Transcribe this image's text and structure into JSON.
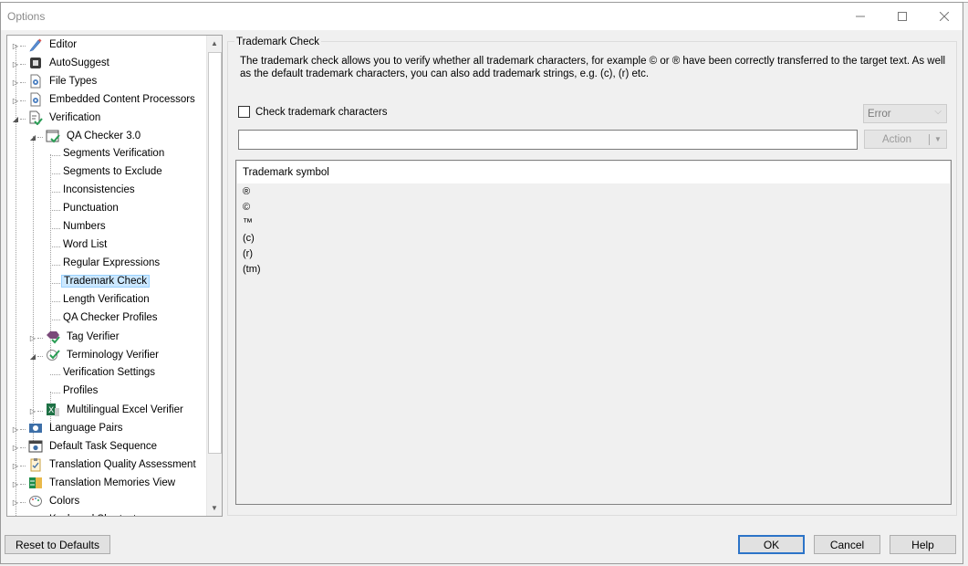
{
  "window": {
    "title": "Options",
    "controls": {
      "minimize": "minimize-icon",
      "maximize": "maximize-icon",
      "close": "close-icon"
    }
  },
  "tree": {
    "items": [
      {
        "label": "Editor",
        "level": 0,
        "expander": "collapsed",
        "icon": "pencil-icon"
      },
      {
        "label": "AutoSuggest",
        "level": 0,
        "expander": "collapsed",
        "icon": "autosuggest-icon"
      },
      {
        "label": "File Types",
        "level": 0,
        "expander": "collapsed",
        "icon": "gear-document-icon"
      },
      {
        "label": "Embedded Content Processors",
        "level": 0,
        "expander": "collapsed",
        "icon": "gear-document-icon"
      },
      {
        "label": "Verification",
        "level": 0,
        "expander": "expanded",
        "icon": "verification-document-icon"
      },
      {
        "label": "QA Checker 3.0",
        "level": 1,
        "expander": "expanded",
        "icon": "qa-checker-icon"
      },
      {
        "label": "Segments Verification",
        "level": 2,
        "expander": "none",
        "icon": ""
      },
      {
        "label": "Segments to Exclude",
        "level": 2,
        "expander": "none",
        "icon": ""
      },
      {
        "label": "Inconsistencies",
        "level": 2,
        "expander": "none",
        "icon": ""
      },
      {
        "label": "Punctuation",
        "level": 2,
        "expander": "none",
        "icon": ""
      },
      {
        "label": "Numbers",
        "level": 2,
        "expander": "none",
        "icon": ""
      },
      {
        "label": "Word List",
        "level": 2,
        "expander": "none",
        "icon": ""
      },
      {
        "label": "Regular Expressions",
        "level": 2,
        "expander": "none",
        "icon": ""
      },
      {
        "label": "Trademark Check",
        "level": 2,
        "expander": "none",
        "icon": "",
        "selected": true
      },
      {
        "label": "Length Verification",
        "level": 2,
        "expander": "none",
        "icon": ""
      },
      {
        "label": "QA Checker Profiles",
        "level": 2,
        "expander": "none",
        "icon": ""
      },
      {
        "label": "Tag Verifier",
        "level": 1,
        "expander": "collapsed",
        "icon": "tag-verifier-icon"
      },
      {
        "label": "Terminology Verifier",
        "level": 1,
        "expander": "expanded",
        "icon": "terminology-verifier-icon"
      },
      {
        "label": "Verification Settings",
        "level": 2,
        "expander": "none",
        "icon": ""
      },
      {
        "label": "Profiles",
        "level": 2,
        "expander": "none",
        "icon": ""
      },
      {
        "label": "Multilingual Excel Verifier",
        "level": 1,
        "expander": "collapsed",
        "icon": "excel-icon"
      },
      {
        "label": "Language Pairs",
        "level": 0,
        "expander": "collapsed",
        "icon": "language-pairs-icon"
      },
      {
        "label": "Default Task Sequence",
        "level": 0,
        "expander": "collapsed",
        "icon": "gear-window-icon"
      },
      {
        "label": "Translation Quality Assessment",
        "level": 0,
        "expander": "collapsed",
        "icon": "clipboard-icon"
      },
      {
        "label": "Translation Memories View",
        "level": 0,
        "expander": "collapsed",
        "icon": "translation-memories-icon"
      },
      {
        "label": "Colors",
        "level": 0,
        "expander": "collapsed",
        "icon": "palette-icon"
      },
      {
        "label": "Keyboard Shortcuts",
        "level": 0,
        "expander": "collapsed",
        "icon": "keyboard-icon"
      }
    ]
  },
  "panel": {
    "group_title": "Trademark Check",
    "description": "The trademark check allows you to verify whether all trademark characters, for example © or ® have been correctly transferred to the target text. As well as the default trademark characters, you can also add trademark strings, e.g. (c), (r) etc.",
    "checkbox_label": "Check trademark characters",
    "checkbox_checked": false,
    "severity_value": "Error",
    "input_value": "",
    "action_label": "Action",
    "list": {
      "header": "Trademark symbol",
      "rows": [
        "®",
        "©",
        "™",
        "(c)",
        "(r)",
        "(tm)"
      ]
    }
  },
  "footer": {
    "reset_label": "Reset to Defaults",
    "ok_label": "OK",
    "cancel_label": "Cancel",
    "help_label": "Help"
  }
}
